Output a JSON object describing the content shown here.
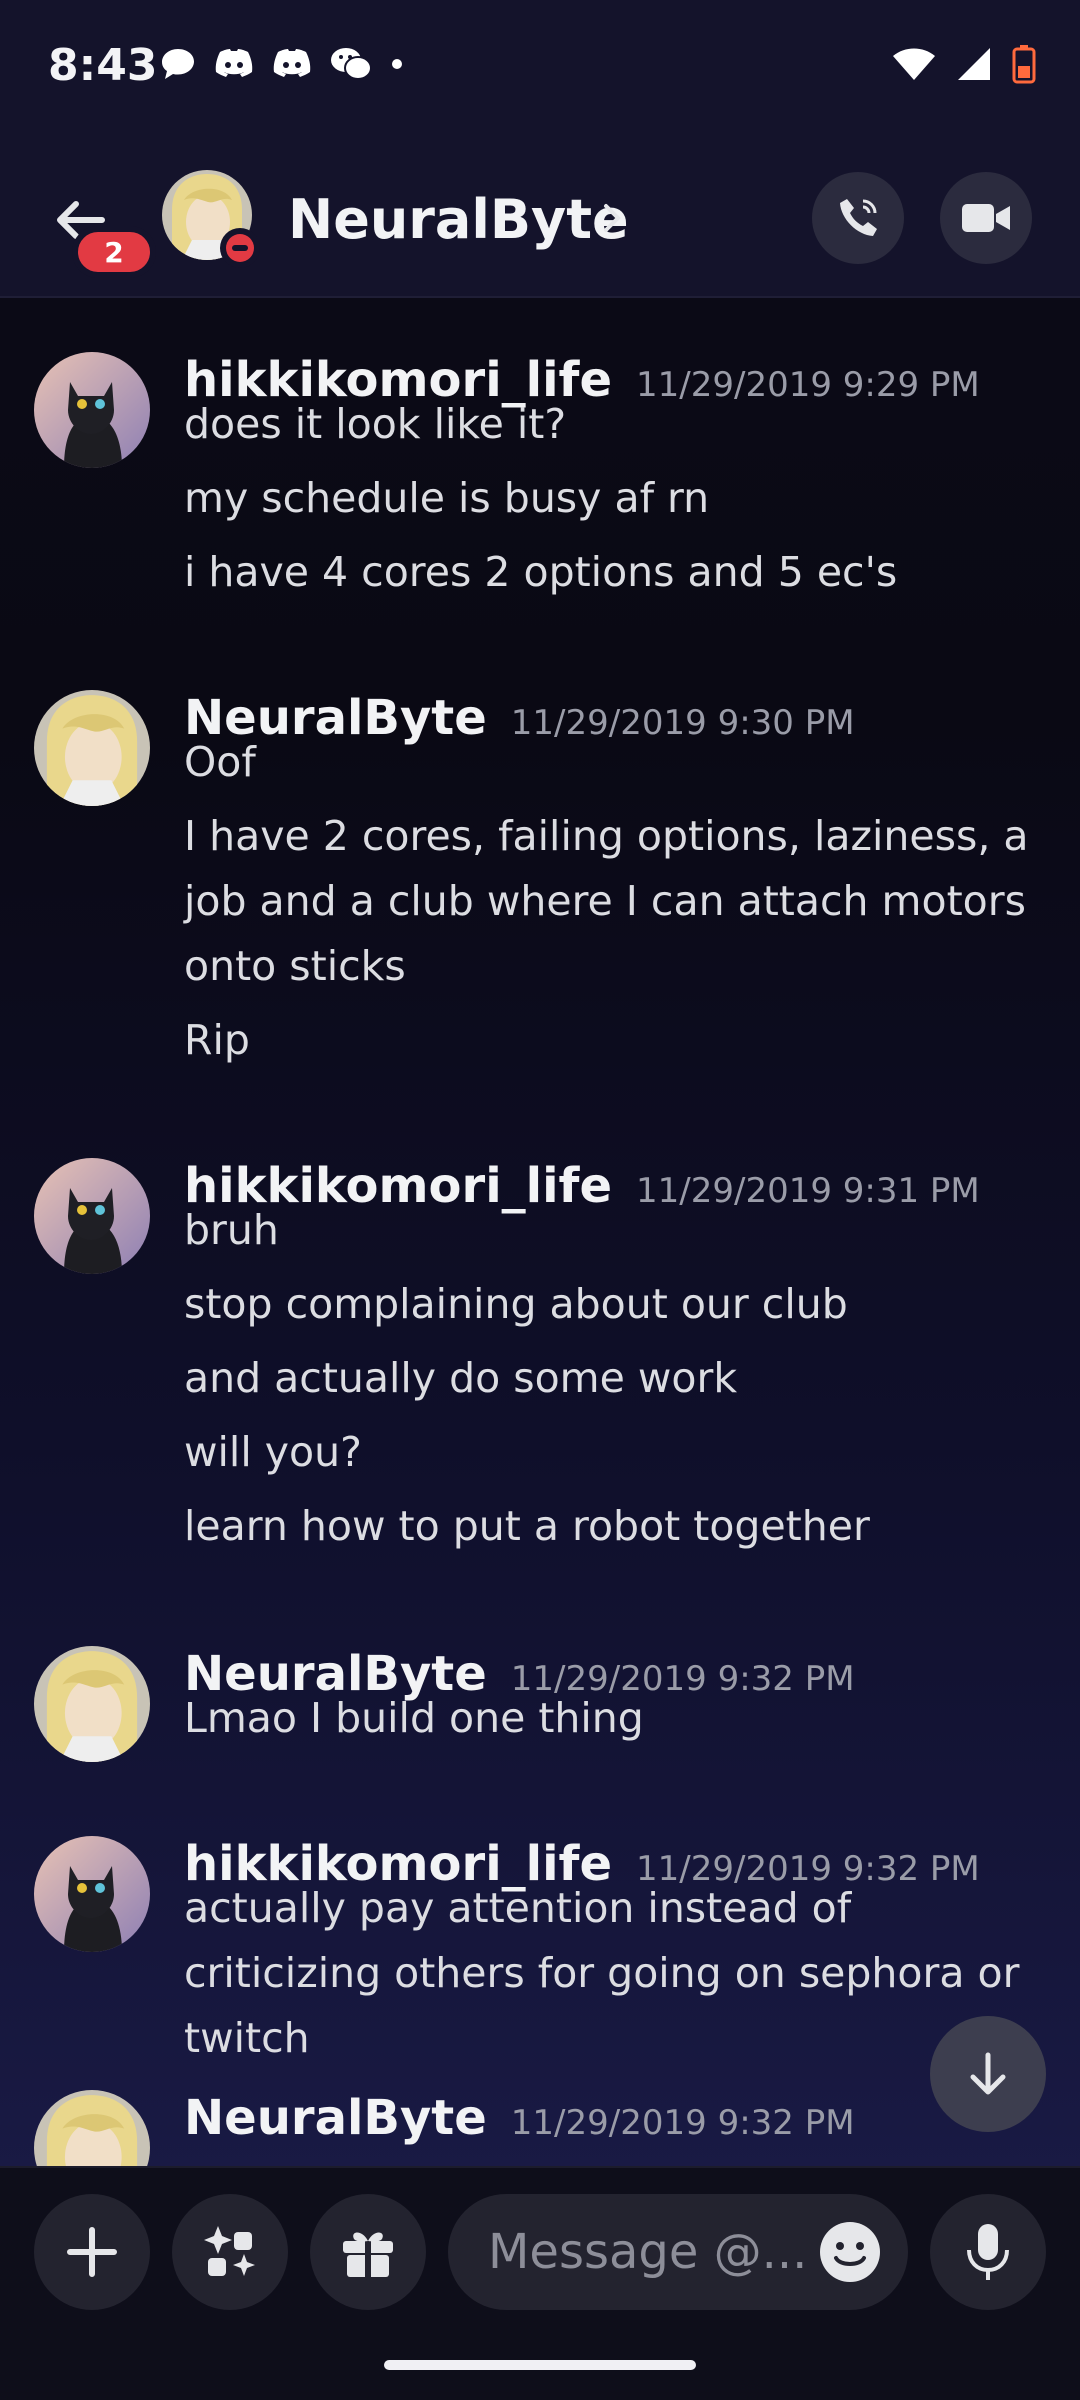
{
  "status_bar": {
    "time": "8:43",
    "left_icons": [
      "chat-bubble-icon",
      "discord-icon",
      "discord-icon",
      "wechat-icon",
      "dot-icon"
    ],
    "right_icons": [
      "wifi-icon",
      "signal-icon",
      "battery-low-icon"
    ]
  },
  "header": {
    "title": "NeuralByte",
    "unread_badge": "2",
    "status": "do-not-disturb"
  },
  "messages": [
    {
      "author": "hikkikomori_life",
      "timestamp": "11/29/2019 9:29 PM",
      "avatar": "black-cat-avatar",
      "lines": [
        "does it look like it?",
        "my schedule is busy af rn",
        "i have 4 cores 2 options and 5 ec's"
      ]
    },
    {
      "author": "NeuralByte",
      "timestamp": "11/29/2019 9:30 PM",
      "avatar": "blond-anime-avatar",
      "lines": [
        "Oof",
        "I have 2 cores, failing options, laziness, a job and a club where I can attach motors onto sticks",
        "Rip"
      ]
    },
    {
      "author": "hikkikomori_life",
      "timestamp": "11/29/2019 9:31 PM",
      "avatar": "black-cat-avatar",
      "lines": [
        "bruh",
        "stop complaining about our club",
        "and actually do some work",
        "will you?",
        "learn how to put a robot together"
      ]
    },
    {
      "author": "NeuralByte",
      "timestamp": "11/29/2019 9:32 PM",
      "avatar": "blond-anime-avatar",
      "lines": [
        "Lmao I build one thing"
      ]
    },
    {
      "author": "hikkikomori_life",
      "timestamp": "11/29/2019 9:32 PM",
      "avatar": "black-cat-avatar",
      "lines": [
        "actually pay attention instead of criticizing others for going on sephora or twitch"
      ]
    },
    {
      "author": "NeuralByte",
      "timestamp": "11/29/2019 9:32 PM",
      "avatar": "blond-anime-avatar",
      "lines": []
    }
  ],
  "composer": {
    "placeholder": "Message @..."
  },
  "colors": {
    "accent_red": "#e23a43",
    "bg_dark": "#0c0b18",
    "bg_bottom": "#1c1d4c",
    "text_primary": "#f2f3f5",
    "text_muted": "#9a9ca8"
  }
}
